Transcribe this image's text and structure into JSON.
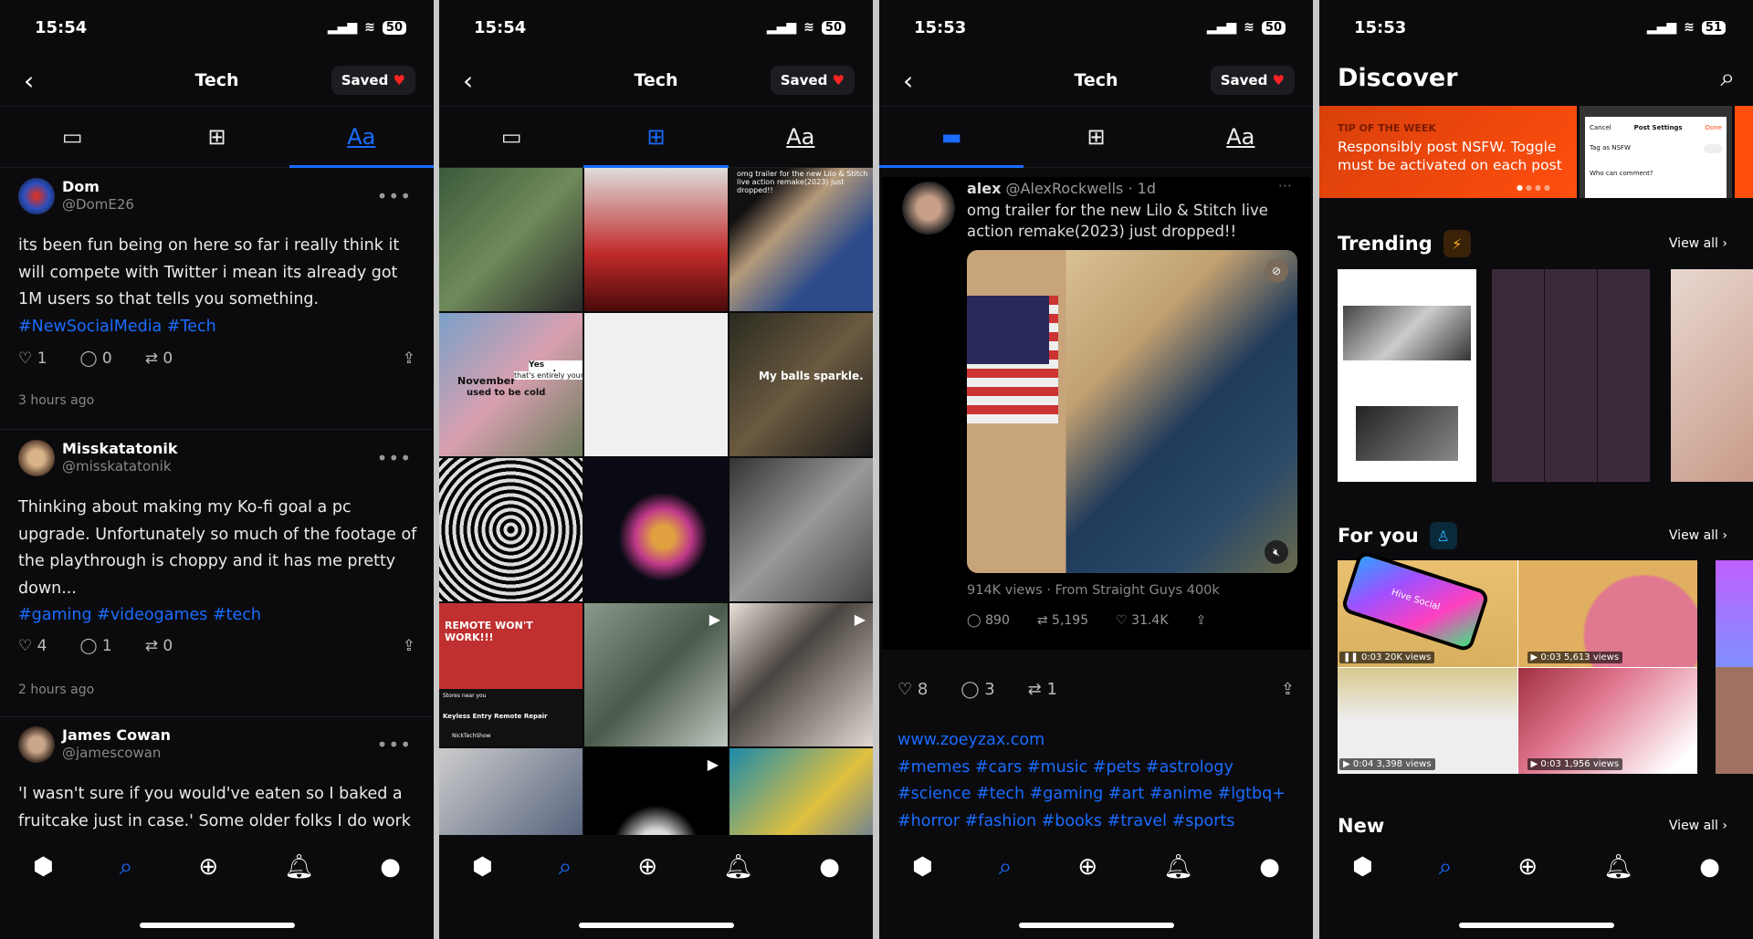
{
  "colors": {
    "accent": "#1a6cff",
    "heart": "#ff2222",
    "tip_orange": "#ff4e0e",
    "bg": "#0b0b0e"
  },
  "status_bars": [
    {
      "time": "15:54",
      "battery": "50"
    },
    {
      "time": "15:54",
      "battery": "50"
    },
    {
      "time": "15:53",
      "battery": "50"
    },
    {
      "time": "15:53",
      "battery": "51"
    }
  ],
  "header": {
    "title": "Tech",
    "saved_label": "Saved",
    "back_icon": "chevron-left",
    "saved_icon": "heart"
  },
  "tabs": [
    "list-view-icon",
    "grid-view-icon",
    "text-view-icon"
  ],
  "nav": [
    "hive-home-icon",
    "search-icon",
    "create-plus-icon",
    "bell-icon",
    "profile-avatar-icon"
  ],
  "panel1": {
    "posts": [
      {
        "name": "Dom",
        "handle": "@DomE26",
        "text": "its been fun being on here so far i really think it will compete with Twitter i mean its already got 1M users so that tells you something.",
        "tags": "#NewSocialMedia #Tech",
        "likes": "1",
        "comments": "0",
        "reposts": "0",
        "time": "3 hours ago"
      },
      {
        "name": "Misskatatonik",
        "handle": "@misskatatonik",
        "text": "Thinking about making my Ko-fi goal a pc upgrade. Unfortunately so much of the footage of the playthrough is choppy and it has me pretty down...",
        "tags": "#gaming #videogames #tech",
        "likes": "4",
        "comments": "1",
        "reposts": "0",
        "time": "2 hours ago"
      },
      {
        "name": "James Cowan",
        "handle": "@jamescowan",
        "text": "'I wasn't sure if you would've eaten so I baked a fruitcake just in case.' Some older folks I do work",
        "tags": "",
        "likes": "",
        "comments": "",
        "reposts": "",
        "time": ""
      }
    ]
  },
  "panel2": {
    "captions": {
      "tweet": "omg trailer for the new Lilo & Stitch live action remake(2023) just dropped!!",
      "meme1a": "November",
      "meme1b": "Yes grandma",
      "meme1c": "used to be cold",
      "meme1d": "that's entirely your fault",
      "meme2": "My balls sparkle.",
      "meme3": "REMOTE WON'T WORK!!!",
      "yt_title": "Keyless Entry Remote Repair",
      "yt_channel": "NickTechShow",
      "yt_store": "Stores near you"
    }
  },
  "panel3": {
    "embedded": {
      "name": "alex",
      "handle": "@AlexRockwells",
      "age": "1d",
      "text": "omg trailer for the new Lilo & Stitch live action remake(2023) just dropped!!",
      "views": "914K views · From Straight Guys 400k",
      "replies": "890",
      "retweets": "5,195",
      "likes": "31.4K"
    },
    "likes": "8",
    "comments": "3",
    "reposts": "1",
    "link": "www.zoeyzax.com",
    "tags": [
      "#memes #cars #music #pets #astrology",
      "#science #tech #gaming #art #anime #lgtbq+",
      "#horror #fashion #books #travel #sports"
    ]
  },
  "panel4": {
    "title": "Discover",
    "tip": {
      "kicker": "TIP OF THE WEEK",
      "text": "Responsibly post NSFW. Toggle must be activated on each post",
      "cancel": "Cancel",
      "settings": "Post Settings",
      "done": "Done",
      "nsfw": "Tag as NSFW",
      "comment": "Who can comment?"
    },
    "trending": "Trending",
    "for_you": "For you",
    "new": "New",
    "view_all": "View all",
    "videos": [
      {
        "duration": "0:03",
        "views": "20K views"
      },
      {
        "duration": "0:03",
        "views": "5,613 views"
      },
      {
        "duration": "0:04",
        "views": "3,398 views"
      },
      {
        "duration": "0:03",
        "views": "1,956 views"
      }
    ],
    "hive_logo": "Hive Social"
  }
}
